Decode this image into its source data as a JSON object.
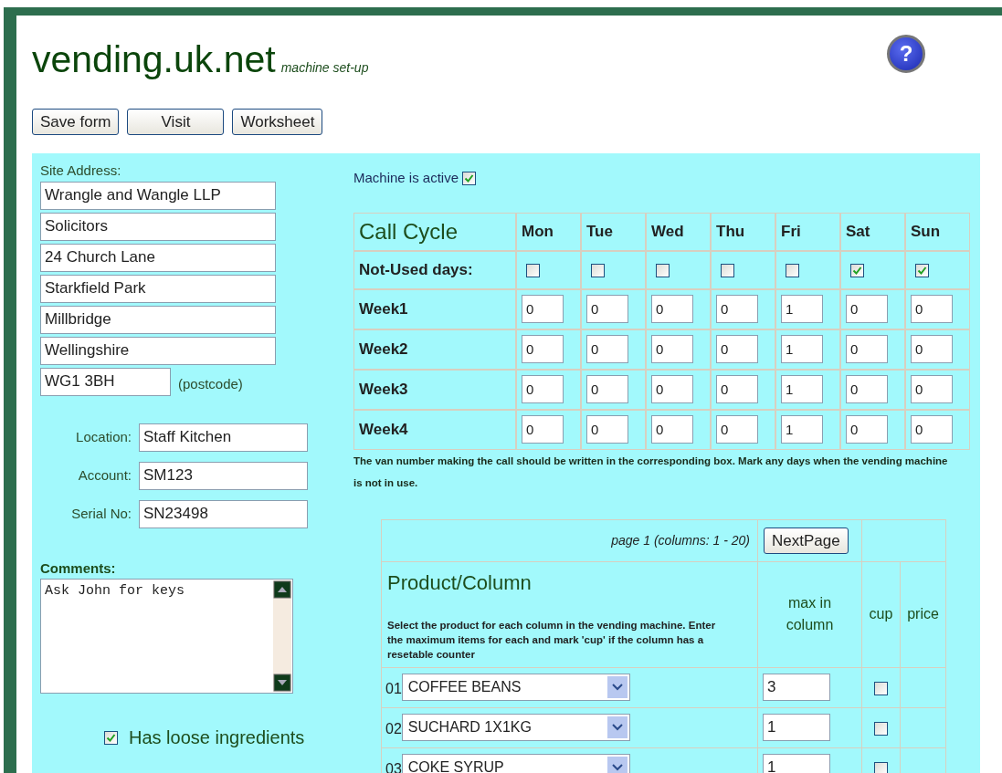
{
  "header": {
    "title": "vending.uk.net",
    "subtitle": "machine set-up",
    "help": "?"
  },
  "buttons": [
    "Save form",
    "Visit",
    "Worksheet"
  ],
  "site_address": {
    "label": "Site Address:",
    "lines": [
      "Wrangle and Wangle LLP",
      "Solicitors",
      "24 Church Lane",
      "Starkfield Park",
      "Millbridge",
      "Wellingshire"
    ],
    "postcode": "WG1 3BH",
    "postcode_note": "(postcode)"
  },
  "details": [
    {
      "label": "Location:",
      "value": "Staff Kitchen"
    },
    {
      "label": "Account:",
      "value": "SM123"
    },
    {
      "label": "Serial No:",
      "value": "SN23498"
    }
  ],
  "comments": {
    "label": "Comments:",
    "value": "Ask John for keys"
  },
  "loose_ingredients": {
    "label": "Has loose ingredients",
    "checked": true
  },
  "machine_active": {
    "label": "Machine is active",
    "checked": true
  },
  "call_cycle": {
    "title": "Call Cycle",
    "not_used_label": "Not-Used days:",
    "days": [
      {
        "label": "Mon",
        "not_used": false
      },
      {
        "label": "Tue",
        "not_used": false
      },
      {
        "label": "Wed",
        "not_used": false
      },
      {
        "label": "Thu",
        "not_used": false
      },
      {
        "label": "Fri",
        "not_used": false
      },
      {
        "label": "Sat",
        "not_used": true
      },
      {
        "label": "Sun",
        "not_used": true
      }
    ],
    "weeks": [
      {
        "label": "Week1",
        "values": [
          "0",
          "0",
          "0",
          "0",
          "1",
          "0",
          "0"
        ]
      },
      {
        "label": "Week2",
        "values": [
          "0",
          "0",
          "0",
          "0",
          "1",
          "0",
          "0"
        ]
      },
      {
        "label": "Week3",
        "values": [
          "0",
          "0",
          "0",
          "0",
          "1",
          "0",
          "0"
        ]
      },
      {
        "label": "Week4",
        "values": [
          "0",
          "0",
          "0",
          "0",
          "1",
          "0",
          "0"
        ]
      }
    ],
    "note": "The van number making the call should be written in the corresponding box. Mark any days when the vending machine is not in use."
  },
  "products": {
    "page_info": "page 1 (columns: 1 - 20)",
    "next_button": "NextPage",
    "title": "Product/Column",
    "instructions": "Select the product for each column in the vending machine. Enter the maximum items for each and mark 'cup' if the column has a resetable counter",
    "columns": [
      "max in column",
      "cup",
      "price"
    ],
    "rows": [
      {
        "number": "01",
        "product": "COFFEE BEANS",
        "max": "3",
        "cup": false
      },
      {
        "number": "02",
        "product": "SUCHARD 1X1KG",
        "max": "1",
        "cup": false
      },
      {
        "number": "03",
        "product": "COKE SYRUP",
        "max": "1",
        "cup": false
      }
    ]
  }
}
